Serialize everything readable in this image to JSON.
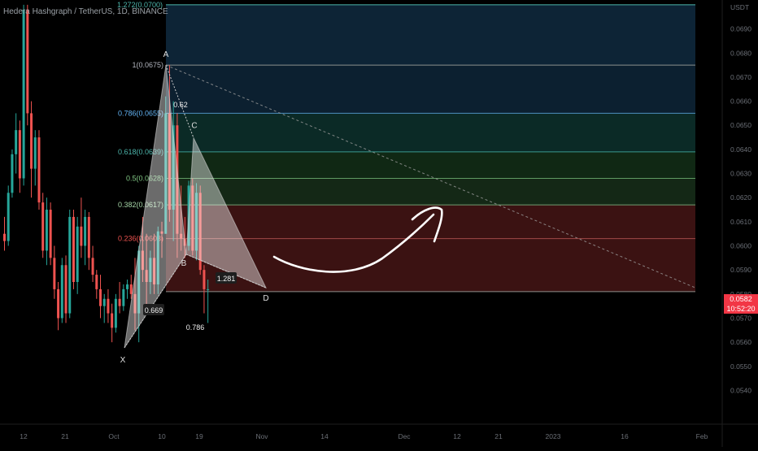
{
  "header": {
    "title": "Hedera Hashgraph / TetherUS, 1D, BINANCE"
  },
  "price_axis": {
    "unit": "USDT",
    "current_price": "0.0582",
    "countdown": "10:52:20"
  },
  "colors": {
    "background": "#000000",
    "up_candle": "#26a69a",
    "down_candle": "#ef5350",
    "pattern_fill": "#ffffff",
    "arrow": "#ffffff",
    "price_tag": "#f23645"
  },
  "chart_data": {
    "type": "candlestick",
    "title": "Hedera Hashgraph / TetherUS, 1D, BINANCE",
    "xlabel": "",
    "ylabel": "USDT",
    "ylim": [
      0.0526,
      0.0702
    ],
    "y_ticks": [
      "0.0540",
      "0.0550",
      "0.0560",
      "0.0570",
      "0.0580",
      "0.0590",
      "0.0600",
      "0.0610",
      "0.0620",
      "0.0630",
      "0.0640",
      "0.0650",
      "0.0660",
      "0.0670",
      "0.0680",
      "0.0690",
      "USDT"
    ],
    "x_ticks": [
      "12",
      "21",
      "Oct",
      "10",
      "19",
      "Nov",
      "14",
      "Dec",
      "12",
      "21",
      "2023",
      "16",
      "Feb"
    ],
    "grid": false,
    "candles": [
      {
        "o": 0.0605,
        "h": 0.0612,
        "l": 0.0598,
        "c": 0.0602
      },
      {
        "o": 0.0602,
        "h": 0.0625,
        "l": 0.06,
        "c": 0.0622
      },
      {
        "o": 0.0622,
        "h": 0.064,
        "l": 0.062,
        "c": 0.0638
      },
      {
        "o": 0.0638,
        "h": 0.0655,
        "l": 0.063,
        "c": 0.0648
      },
      {
        "o": 0.0648,
        "h": 0.0652,
        "l": 0.0622,
        "c": 0.0628
      },
      {
        "o": 0.0628,
        "h": 0.07,
        "l": 0.0625,
        "c": 0.0698
      },
      {
        "o": 0.0698,
        "h": 0.07,
        "l": 0.065,
        "c": 0.0655
      },
      {
        "o": 0.0655,
        "h": 0.066,
        "l": 0.062,
        "c": 0.0632
      },
      {
        "o": 0.0632,
        "h": 0.0648,
        "l": 0.0625,
        "c": 0.0645
      },
      {
        "o": 0.0645,
        "h": 0.0648,
        "l": 0.0615,
        "c": 0.0618
      },
      {
        "o": 0.0618,
        "h": 0.0622,
        "l": 0.0595,
        "c": 0.0598
      },
      {
        "o": 0.0598,
        "h": 0.062,
        "l": 0.0592,
        "c": 0.0615
      },
      {
        "o": 0.0615,
        "h": 0.0618,
        "l": 0.0592,
        "c": 0.0595
      },
      {
        "o": 0.0595,
        "h": 0.06,
        "l": 0.0578,
        "c": 0.0582
      },
      {
        "o": 0.0582,
        "h": 0.0585,
        "l": 0.0565,
        "c": 0.057
      },
      {
        "o": 0.057,
        "h": 0.0595,
        "l": 0.0568,
        "c": 0.0592
      },
      {
        "o": 0.0592,
        "h": 0.0596,
        "l": 0.0568,
        "c": 0.0572
      },
      {
        "o": 0.0572,
        "h": 0.0615,
        "l": 0.057,
        "c": 0.0612
      },
      {
        "o": 0.0612,
        "h": 0.0615,
        "l": 0.0582,
        "c": 0.0585
      },
      {
        "o": 0.0585,
        "h": 0.0612,
        "l": 0.058,
        "c": 0.0608
      },
      {
        "o": 0.0608,
        "h": 0.062,
        "l": 0.0595,
        "c": 0.06
      },
      {
        "o": 0.06,
        "h": 0.0615,
        "l": 0.0592,
        "c": 0.0612
      },
      {
        "o": 0.0612,
        "h": 0.0614,
        "l": 0.059,
        "c": 0.0595
      },
      {
        "o": 0.0595,
        "h": 0.06,
        "l": 0.0585,
        "c": 0.0588
      },
      {
        "o": 0.0588,
        "h": 0.059,
        "l": 0.0578,
        "c": 0.0582
      },
      {
        "o": 0.0582,
        "h": 0.0588,
        "l": 0.057,
        "c": 0.0575
      },
      {
        "o": 0.0575,
        "h": 0.058,
        "l": 0.0568,
        "c": 0.0578
      },
      {
        "o": 0.0578,
        "h": 0.0582,
        "l": 0.0568,
        "c": 0.0572
      },
      {
        "o": 0.0572,
        "h": 0.0576,
        "l": 0.056,
        "c": 0.0566
      },
      {
        "o": 0.0566,
        "h": 0.058,
        "l": 0.0564,
        "c": 0.0578
      },
      {
        "o": 0.0578,
        "h": 0.0585,
        "l": 0.0572,
        "c": 0.0575
      },
      {
        "o": 0.0575,
        "h": 0.0584,
        "l": 0.0573,
        "c": 0.0582
      },
      {
        "o": 0.0582,
        "h": 0.0586,
        "l": 0.0578,
        "c": 0.0584
      },
      {
        "o": 0.0584,
        "h": 0.0588,
        "l": 0.0578,
        "c": 0.058
      },
      {
        "o": 0.058,
        "h": 0.0595,
        "l": 0.0565,
        "c": 0.0572
      },
      {
        "o": 0.0572,
        "h": 0.06,
        "l": 0.056,
        "c": 0.0598
      },
      {
        "o": 0.0598,
        "h": 0.0612,
        "l": 0.0585,
        "c": 0.059
      },
      {
        "o": 0.059,
        "h": 0.0605,
        "l": 0.0575,
        "c": 0.0585
      },
      {
        "o": 0.0585,
        "h": 0.0598,
        "l": 0.058,
        "c": 0.0595
      },
      {
        "o": 0.0595,
        "h": 0.0605,
        "l": 0.058,
        "c": 0.0584
      },
      {
        "o": 0.0584,
        "h": 0.0608,
        "l": 0.058,
        "c": 0.0606
      },
      {
        "o": 0.0606,
        "h": 0.061,
        "l": 0.0595,
        "c": 0.0605
      },
      {
        "o": 0.0605,
        "h": 0.0662,
        "l": 0.0605,
        "c": 0.0655
      },
      {
        "o": 0.0655,
        "h": 0.0675,
        "l": 0.061,
        "c": 0.0615
      },
      {
        "o": 0.0615,
        "h": 0.066,
        "l": 0.0602,
        "c": 0.065
      },
      {
        "o": 0.065,
        "h": 0.0655,
        "l": 0.0595,
        "c": 0.0605
      },
      {
        "o": 0.0605,
        "h": 0.0625,
        "l": 0.0598,
        "c": 0.0603
      },
      {
        "o": 0.0603,
        "h": 0.0612,
        "l": 0.0595,
        "c": 0.06
      },
      {
        "o": 0.06,
        "h": 0.0627,
        "l": 0.0598,
        "c": 0.0625
      },
      {
        "o": 0.0625,
        "h": 0.0628,
        "l": 0.0596,
        "c": 0.0598
      },
      {
        "o": 0.0598,
        "h": 0.0626,
        "l": 0.0594,
        "c": 0.0622
      },
      {
        "o": 0.0622,
        "h": 0.0625,
        "l": 0.0588,
        "c": 0.059
      },
      {
        "o": 0.059,
        "h": 0.0592,
        "l": 0.0572,
        "c": 0.0582
      },
      {
        "o": 0.0582,
        "h": 0.0586,
        "l": 0.0568,
        "c": 0.0582
      }
    ],
    "fib_levels": [
      {
        "ratio": 1.0,
        "price": 0.0675,
        "label": "1(0.0675)",
        "label_color": "#b2b5be",
        "line": "#8c8f8c",
        "fill": "#1c1c1c"
      },
      {
        "ratio": 0.786,
        "price": 0.0655,
        "label": "0.786(0.0655)",
        "label_color": "#64b5f6",
        "line": "#4d8fc0",
        "fill": "#0c2030"
      },
      {
        "ratio": 0.618,
        "price": 0.0639,
        "label": "0.618(0.0639)",
        "label_color": "#4db6ac",
        "line": "#3a9a8e",
        "fill": "#0b2a26"
      },
      {
        "ratio": 0.5,
        "price": 0.0628,
        "label": "0.5(0.0628)",
        "label_color": "#81c784",
        "line": "#5f9a62",
        "fill": "#102814"
      },
      {
        "ratio": 0.382,
        "price": 0.0617,
        "label": "0.382(0.0617)",
        "label_color": "#a5d6a7",
        "line": "#6f9e72",
        "fill": "#142816"
      },
      {
        "ratio": 0.236,
        "price": 0.0603,
        "label": "0.236(0.0603)",
        "label_color": "#ef5350",
        "line": "#a04a48",
        "fill": "#3b1212"
      },
      {
        "ratio": 0.0,
        "price": 0.0581,
        "label": "",
        "label_color": "#b2b5be",
        "line": "#8c8f8c",
        "fill": "#3b1212"
      }
    ],
    "fib_top": {
      "price": 0.07,
      "label": "1.272(0.0700)",
      "fill": "#0d2436"
    },
    "pattern": {
      "points": [
        {
          "label": "X",
          "price": 0.05577
        },
        {
          "label": "A",
          "price": 0.0675
        },
        {
          "label": "B",
          "price": 0.05965
        },
        {
          "label": "C",
          "price": 0.06448
        },
        {
          "label": "D",
          "price": 0.05826
        }
      ],
      "ratios": [
        "0.669",
        "0.62",
        "1.281",
        "0.786"
      ]
    },
    "annotations": [
      "projected move up (hand-drawn arrow)"
    ],
    "trendline": "dashed line from A descending to the right"
  }
}
